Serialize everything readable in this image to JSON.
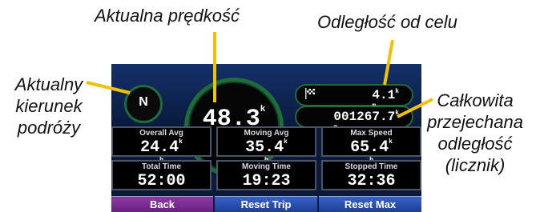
{
  "callouts": {
    "speed": "Aktualna prędkość",
    "distance": "Odległość od celu",
    "heading_line1": "Aktualny",
    "heading_line2": "kierunek",
    "heading_line3": "podróży",
    "odo_line1": "Całkowita",
    "odo_line2": "przejechana",
    "odo_line3": "odległość",
    "odo_line4": "(licznik)"
  },
  "screen": {
    "heading": "N",
    "speed": {
      "value": "48.3",
      "unit_top": "k",
      "unit_bottom": "h"
    },
    "distance_to_dest": {
      "value": "4.1",
      "unit_top": "k",
      "unit_bottom": "m"
    },
    "odometer": {
      "value": "001267.7",
      "unit_top": "k",
      "unit_bottom": "m"
    }
  },
  "tiles": [
    {
      "label": "Overall Avg",
      "value": "24.4",
      "unit_top": "k",
      "unit_bottom": "h"
    },
    {
      "label": "Moving Avg",
      "value": "35.4",
      "unit_top": "k",
      "unit_bottom": "h"
    },
    {
      "label": "Max Speed",
      "value": "65.4",
      "unit_top": "k",
      "unit_bottom": "h"
    },
    {
      "label": "Total Time",
      "value": "52:00"
    },
    {
      "label": "Moving Time",
      "value": "19:23"
    },
    {
      "label": "Stopped Time",
      "value": "32:36"
    }
  ],
  "buttons": {
    "back": "Back",
    "reset_trip": "Reset Trip",
    "reset_max": "Reset Max"
  },
  "colors": {
    "callout_line": "#f2c200",
    "ring_green": "#1f6b3c",
    "back_button": "#7a2a92",
    "reset_button": "#2a4fb0"
  }
}
